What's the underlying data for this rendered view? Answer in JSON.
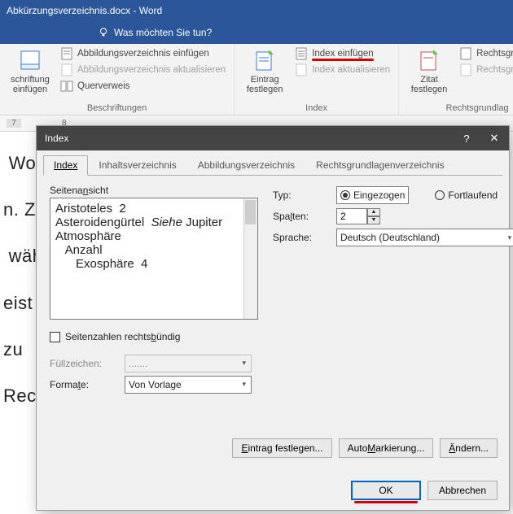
{
  "titlebar": {
    "title": "Abkürzungsverzeichnis.docx - Word"
  },
  "tellme": {
    "text": "Was möchten Sie tun?"
  },
  "ribbon": {
    "group1": {
      "big": "schriftung\neinfügen",
      "s1": "Abbildungsverzeichnis einfügen",
      "s2": "Abbildungsverzeichnis aktualisieren",
      "s3": "Querverweis",
      "label": "Beschriftungen"
    },
    "group2": {
      "big": "Eintrag\nfestlegen",
      "s1": "Index einfügen",
      "s2": "Index aktualisieren",
      "label": "Index"
    },
    "group3": {
      "big": "Zitat\nfestlegen",
      "s1": "Rechtsgrundlage",
      "s2": "Rechtsgrundlag",
      "label": "Rechtsgrundlag"
    }
  },
  "ruler": {
    "m1": "7",
    "m2": "8"
  },
  "doc": {
    "l1": " Wo",
    "l2": "n. Zu",
    "l3": "",
    "l4": " wäh",
    "l5": "",
    "l6": "eist",
    "l7": "zu",
    "l8": "",
    "l9": "Rec"
  },
  "dialog": {
    "title": "Index",
    "help": "?",
    "close": "✕",
    "tabs": {
      "t1": "Index",
      "t2": "Inhaltsverzeichnis",
      "t3": "Abbildungsverzeichnis",
      "t4": "Rechtsgrundlagenverzeichnis"
    },
    "preview_label": "Seitenansicht",
    "preview": {
      "l1": "Aristoteles  2",
      "l2_a": "Asteroidengürtel  ",
      "l2_b": "Siehe",
      "l2_c": " Jupiter",
      "l3": "Atmosphäre",
      "l4": "   Anzahl",
      "l5": "",
      "l6": "      Exosphäre  4"
    },
    "typ_label": "Typ:",
    "typ_opt1": "Eingezogen",
    "typ_opt2": "Fortlaufend",
    "spalten_label": "Spalten:",
    "spalten_value": "2",
    "sprache_label": "Sprache:",
    "sprache_value": "Deutsch (Deutschland)",
    "chk_label": "Seitenzahlen rechtsbündig",
    "fuell_label": "Füllzeichen:",
    "fuell_value": ".......",
    "formate_label": "Formate:",
    "formate_value": "Von Vorlage",
    "btn_eintrag": "Eintrag festlegen...",
    "btn_auto": "AutoMarkierung...",
    "btn_aendern": "Ändern...",
    "btn_ok": "OK",
    "btn_cancel": "Abbrechen"
  }
}
